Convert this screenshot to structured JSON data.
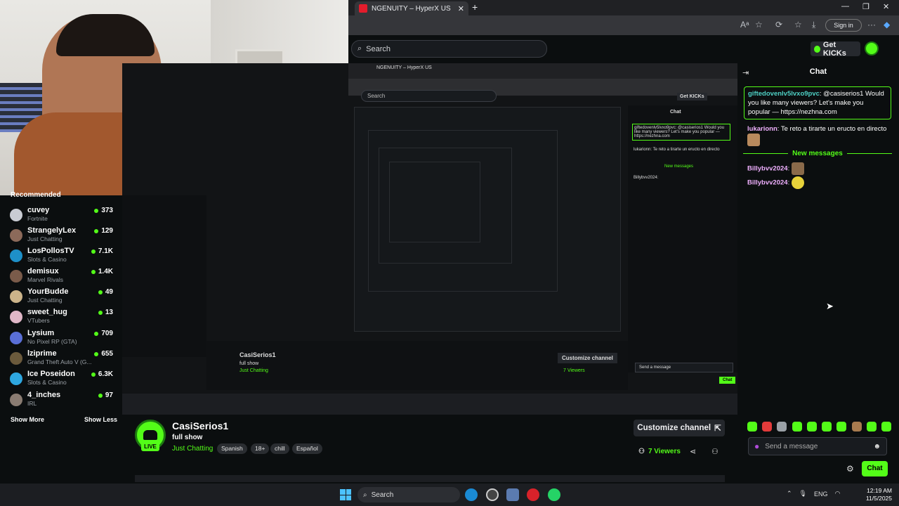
{
  "browser": {
    "tab_title": "NGENUITY – HyperX US",
    "sign_in": "Sign in"
  },
  "header": {
    "search_placeholder": "Search",
    "get_kicks": "Get KICKs"
  },
  "sidebar": {
    "title": "Recommended",
    "channels": [
      {
        "name": "cuvey",
        "category": "Fortnite",
        "viewers": "373"
      },
      {
        "name": "StrangelyLex",
        "category": "Just Chatting",
        "viewers": "129"
      },
      {
        "name": "LosPollosTV",
        "category": "Slots & Casino",
        "viewers": "7.1K"
      },
      {
        "name": "demisux",
        "category": "Marvel Rivals",
        "viewers": "1.4K"
      },
      {
        "name": "YourBudde",
        "category": "Just Chatting",
        "viewers": "49"
      },
      {
        "name": "sweet_hug",
        "category": "VTubers",
        "viewers": "13"
      },
      {
        "name": "Lysium",
        "category": "No Pixel RP (GTA)",
        "viewers": "709"
      },
      {
        "name": "lziprime",
        "category": "Grand Theft Auto V (G...",
        "viewers": "655"
      },
      {
        "name": "Ice Poseidon",
        "category": "Slots & Casino",
        "viewers": "6.3K"
      },
      {
        "name": "4_inches",
        "category": "IRL",
        "viewers": "97"
      }
    ],
    "show_more": "Show More",
    "show_less": "Show Less"
  },
  "stream": {
    "live_badge": "LIVE",
    "channel": "CasiSerios1",
    "title": "full show",
    "category": "Just Chatting",
    "tags": [
      "Spanish",
      "18+",
      "chill",
      "Español"
    ],
    "customize": "Customize channel",
    "viewers": "7 Viewers"
  },
  "chat": {
    "title": "Chat",
    "pinned": {
      "user": "giftedovenlv5lvxo9pvc",
      "text": ": @casiserios1 Would you like many viewers? Let's make you popular — https://nezhna.com"
    },
    "messages": [
      {
        "user": "lukarionn",
        "text": ": Te reto a tirarte un eructo en directo"
      }
    ],
    "new_messages": "New messages",
    "after": [
      {
        "user": "Billybvv2024",
        "text": ":"
      },
      {
        "user": "Billybvv2024",
        "text": ":"
      }
    ],
    "send_placeholder": "Send a message",
    "send_button": "Chat",
    "colors": {
      "accent": "#53fc18",
      "user_cyan": "#4fd1c5",
      "user_pink": "#f0b0ff"
    }
  },
  "nested": {
    "tab_title": "NGENUITY – HyperX US",
    "search": "Search",
    "get_kicks": "Get KICKs",
    "chat_title": "Chat",
    "pinned": "giftedovenlv5lvxo9pvc: @casiserios1 Would you like many viewers? Let's make you popular — https://nezhna.com",
    "msg": "lukarionn: Te reto a tirarte un eructo en directo",
    "new_messages": "New messages",
    "billy": "Billybvv2024:",
    "channel": "CasiSerios1",
    "title": "full show",
    "category": "Just Chatting",
    "customize": "Customize channel",
    "viewers": "7 Viewers",
    "send": "Send a message",
    "chat_btn": "Chat"
  },
  "taskbar": {
    "search": "Search",
    "lang": "ENG",
    "time": "12:19 AM",
    "date": "11/5/2025"
  }
}
